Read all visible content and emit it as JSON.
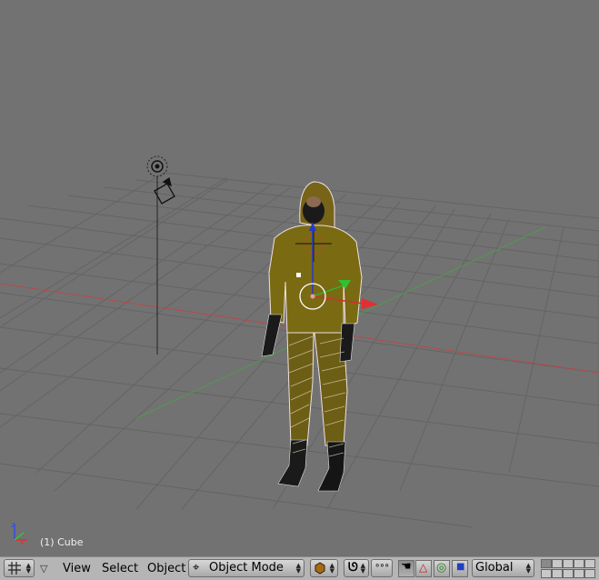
{
  "viewport": {
    "object_label": "(1) Cube",
    "axis_colors": {
      "x": "#e03030",
      "y": "#3ac03a",
      "z": "#3050e0"
    }
  },
  "header": {
    "menus": {
      "view": "View",
      "select": "Select",
      "object": "Object"
    },
    "mode_select": "Object Mode",
    "orientation_select": "Global"
  }
}
